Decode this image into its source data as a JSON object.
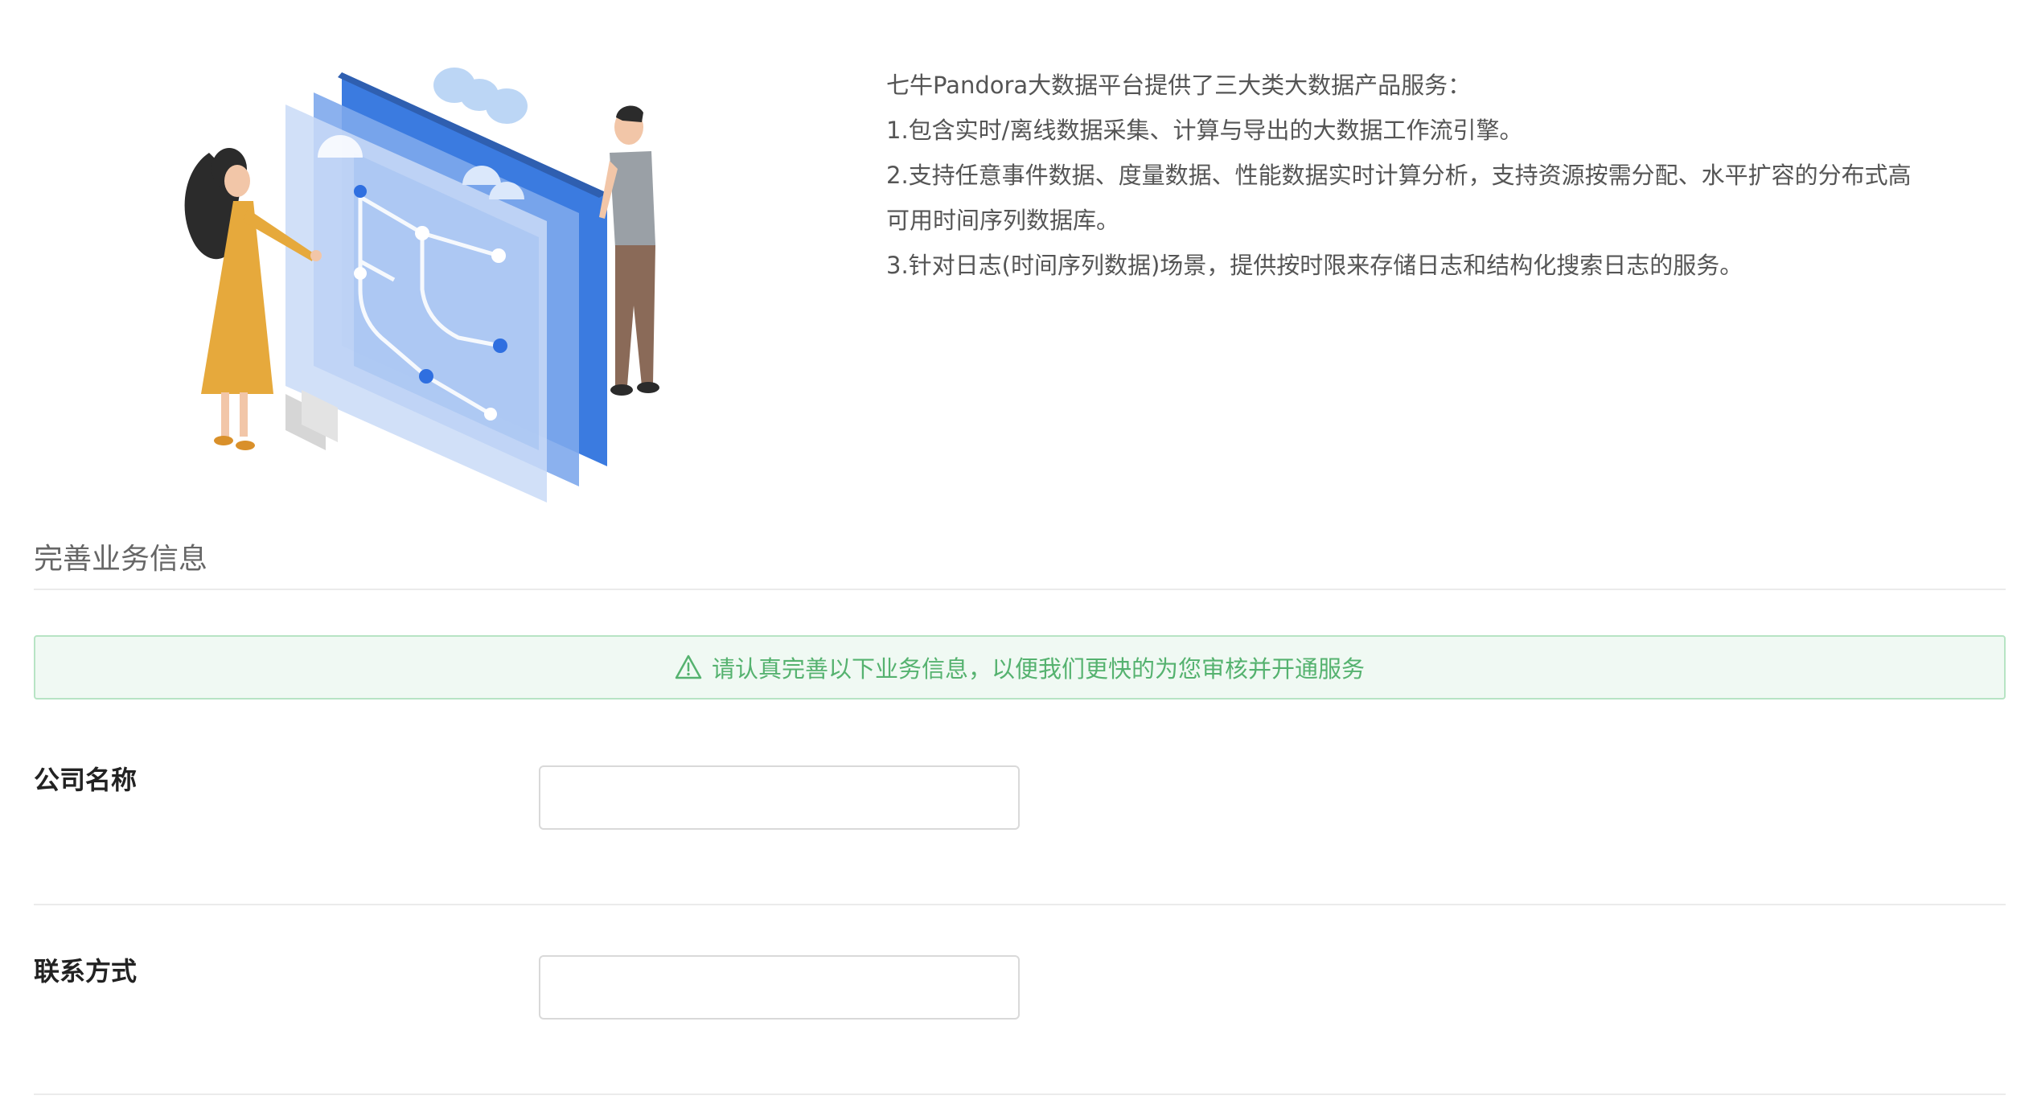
{
  "intro": {
    "lines": [
      "七牛Pandora大数据平台提供了三大类大数据产品服务：",
      "1.包含实时/离线数据采集、计算与导出的大数据工作流引擎。",
      "2.支持任意事件数据、度量数据、性能数据实时计算分析，支持资源按需分配、水平扩容的分布式高",
      "可用时间序列数据库。",
      "3.针对日志(时间序列数据)场景，提供按时限来存储日志和结构化搜索日志的服务。"
    ]
  },
  "section": {
    "title": "完善业务信息"
  },
  "notice": {
    "icon": "warning-icon",
    "text": "请认真完善以下业务信息，以便我们更快的为您审核并开通服务",
    "color": "#55b26f"
  },
  "form": {
    "company": {
      "label": "公司名称",
      "value": ""
    },
    "contact": {
      "label": "联系方式",
      "value": ""
    }
  }
}
